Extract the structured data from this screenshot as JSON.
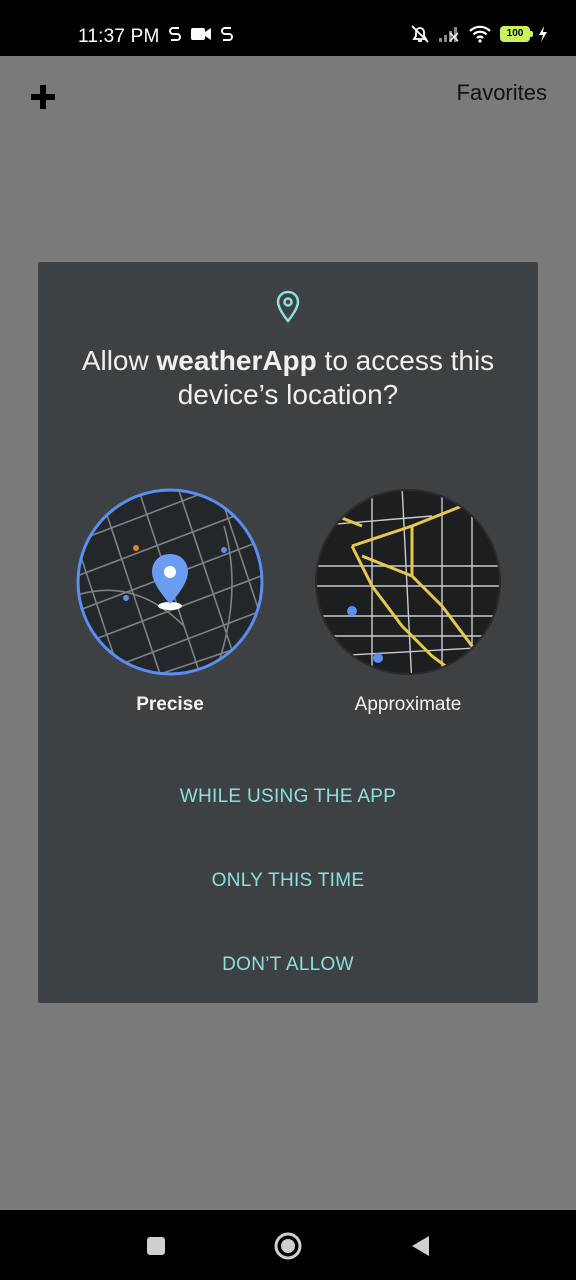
{
  "status_bar": {
    "time": "11:37 PM",
    "battery": "100",
    "left_icons": [
      "s-icon",
      "video-camera-icon",
      "s-icon"
    ],
    "right_icons": [
      "bell-off-icon",
      "signal-icon",
      "wifi-icon",
      "battery-icon",
      "charging-icon"
    ]
  },
  "app_bar": {
    "add_icon": "plus-icon",
    "favorites_label": "Favorites"
  },
  "dialog": {
    "icon": "location-pin-icon",
    "title_prefix": "Allow ",
    "app_name": "weatherApp",
    "title_suffix": " to access this device’s location?",
    "options": [
      {
        "label": "Precise",
        "selected": true
      },
      {
        "label": "Approximate",
        "selected": false
      }
    ],
    "actions": {
      "while_using": "WHILE USING THE APP",
      "only_this_time": "ONLY THIS TIME",
      "dont_allow": "DON’T ALLOW"
    },
    "accent_color": "#8be0de"
  },
  "nav_bar": {
    "buttons": [
      "recent-apps-icon",
      "home-icon",
      "back-icon"
    ]
  }
}
